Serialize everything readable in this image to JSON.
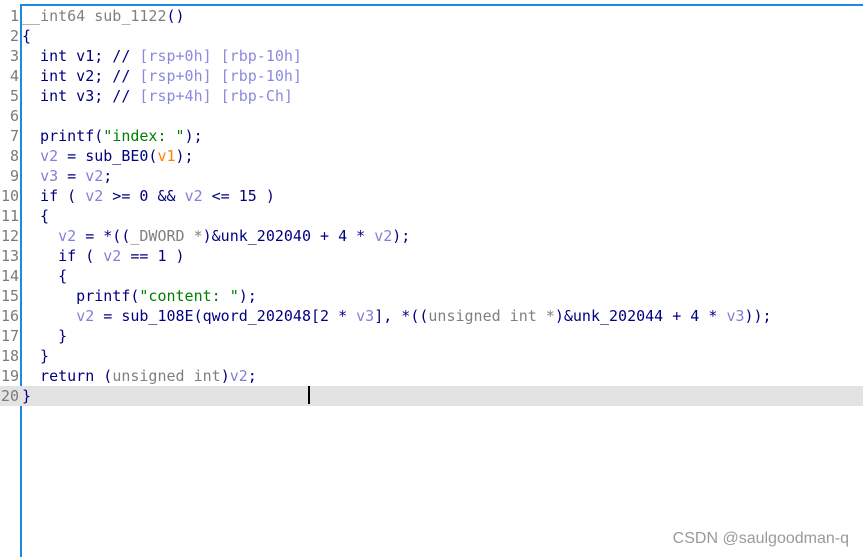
{
  "editor": {
    "current_line": 20,
    "lines": [
      [
        {
          "t": "__int64 sub_1122",
          "c": "g"
        },
        {
          "t": "()",
          "c": "k"
        }
      ],
      [
        {
          "t": "{",
          "c": "k"
        }
      ],
      [
        {
          "t": "  int v1; // ",
          "c": "k"
        },
        {
          "t": "[rsp+0h] [rbp-10h]",
          "c": "c"
        }
      ],
      [
        {
          "t": "  int v2; // ",
          "c": "k"
        },
        {
          "t": "[rsp+0h] [rbp-10h]",
          "c": "c"
        }
      ],
      [
        {
          "t": "  int v3; // ",
          "c": "k"
        },
        {
          "t": "[rsp+4h] [rbp-Ch]",
          "c": "c"
        }
      ],
      [],
      [
        {
          "t": "  printf(",
          "c": "k"
        },
        {
          "t": "\"index: \"",
          "c": "s"
        },
        {
          "t": ");",
          "c": "k"
        }
      ],
      [
        {
          "t": "  ",
          "c": "k"
        },
        {
          "t": "v2",
          "c": "v"
        },
        {
          "t": " = sub_BE0(",
          "c": "k"
        },
        {
          "t": "v1",
          "c": "a"
        },
        {
          "t": ");",
          "c": "k"
        }
      ],
      [
        {
          "t": "  ",
          "c": "k"
        },
        {
          "t": "v3",
          "c": "v"
        },
        {
          "t": " = ",
          "c": "k"
        },
        {
          "t": "v2",
          "c": "v"
        },
        {
          "t": ";",
          "c": "k"
        }
      ],
      [
        {
          "t": "  if ( ",
          "c": "k"
        },
        {
          "t": "v2",
          "c": "v"
        },
        {
          "t": " >= 0 && ",
          "c": "k"
        },
        {
          "t": "v2",
          "c": "v"
        },
        {
          "t": " <= 15 )",
          "c": "k"
        }
      ],
      [
        {
          "t": "  {",
          "c": "k"
        }
      ],
      [
        {
          "t": "    ",
          "c": "k"
        },
        {
          "t": "v2",
          "c": "v"
        },
        {
          "t": " = *((",
          "c": "k"
        },
        {
          "t": "_DWORD *",
          "c": "g"
        },
        {
          "t": ")&unk_202040 + 4 * ",
          "c": "k"
        },
        {
          "t": "v2",
          "c": "v"
        },
        {
          "t": ");",
          "c": "k"
        }
      ],
      [
        {
          "t": "    if ( ",
          "c": "k"
        },
        {
          "t": "v2",
          "c": "v"
        },
        {
          "t": " == 1 )",
          "c": "k"
        }
      ],
      [
        {
          "t": "    {",
          "c": "k"
        }
      ],
      [
        {
          "t": "      printf(",
          "c": "k"
        },
        {
          "t": "\"content: \"",
          "c": "s"
        },
        {
          "t": ");",
          "c": "k"
        }
      ],
      [
        {
          "t": "      ",
          "c": "k"
        },
        {
          "t": "v2",
          "c": "v"
        },
        {
          "t": " = sub_108E(qword_202048[2 * ",
          "c": "k"
        },
        {
          "t": "v3",
          "c": "v"
        },
        {
          "t": "], *((",
          "c": "k"
        },
        {
          "t": "unsigned int *",
          "c": "g"
        },
        {
          "t": ")&unk_202044 + 4 * ",
          "c": "k"
        },
        {
          "t": "v3",
          "c": "v"
        },
        {
          "t": "));",
          "c": "k"
        }
      ],
      [
        {
          "t": "    }",
          "c": "k"
        }
      ],
      [
        {
          "t": "  }",
          "c": "k"
        }
      ],
      [
        {
          "t": "  return (",
          "c": "k"
        },
        {
          "t": "unsigned int",
          "c": "g"
        },
        {
          "t": ")",
          "c": "k"
        },
        {
          "t": "v2",
          "c": "v"
        },
        {
          "t": ";",
          "c": "k"
        }
      ],
      [
        {
          "t": "}",
          "c": "k"
        }
      ]
    ]
  },
  "watermark": "CSDN @saulgoodman-q"
}
